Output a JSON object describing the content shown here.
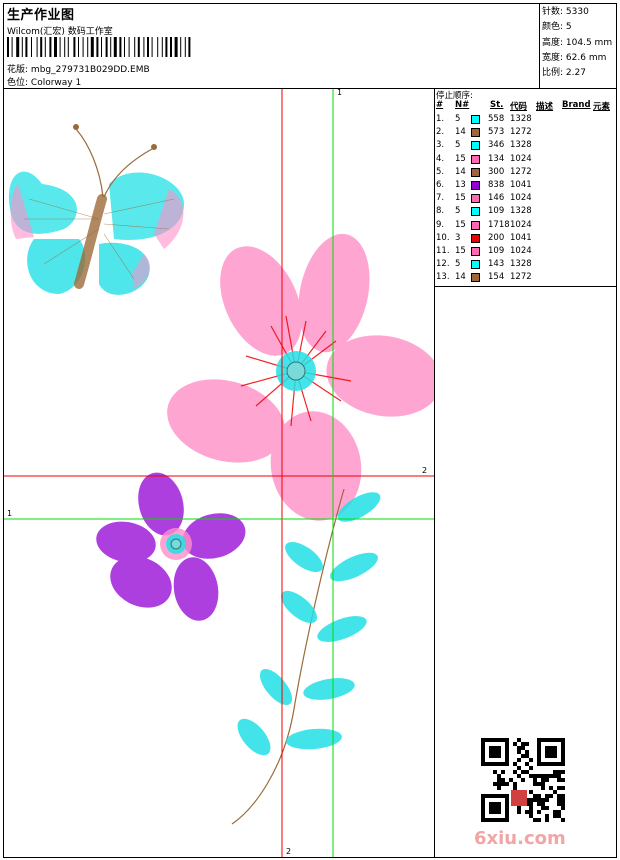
{
  "header": {
    "title": "生产作业图",
    "company": "Wilcom(汇宏) 数码工作室",
    "design_label": "花版:",
    "design_file": "mbg_279731B029DD.EMB",
    "colorway_label": "色位:",
    "colorway": "Colorway 1"
  },
  "stats": [
    {
      "label": "针数:",
      "value": "5330"
    },
    {
      "label": "颜色:",
      "value": "5"
    },
    {
      "label": "高度:",
      "value": "104.5 mm"
    },
    {
      "label": "宽度:",
      "value": "62.6 mm"
    },
    {
      "label": "比例:",
      "value": "2.27"
    }
  ],
  "legend": {
    "title": "停止顺序:",
    "headers": {
      "num": "#",
      "needle": "N#",
      "stitches": "St.",
      "code": "代码",
      "desc": "描述",
      "brand": "Brand",
      "elem": "元素"
    },
    "rows": [
      {
        "n": "1.",
        "needle": "5",
        "color": "#00ffff",
        "st": "558",
        "code": "1328"
      },
      {
        "n": "2.",
        "needle": "14",
        "color": "#a0643c",
        "st": "573",
        "code": "1272"
      },
      {
        "n": "3.",
        "needle": "5",
        "color": "#00ffff",
        "st": "346",
        "code": "1328"
      },
      {
        "n": "4.",
        "needle": "15",
        "color": "#ff69b4",
        "st": "134",
        "code": "1024"
      },
      {
        "n": "5.",
        "needle": "14",
        "color": "#a0643c",
        "st": "300",
        "code": "1272"
      },
      {
        "n": "6.",
        "needle": "13",
        "color": "#9400d3",
        "st": "838",
        "code": "1041"
      },
      {
        "n": "7.",
        "needle": "15",
        "color": "#ff69b4",
        "st": "146",
        "code": "1024"
      },
      {
        "n": "8.",
        "needle": "5",
        "color": "#00ffff",
        "st": "109",
        "code": "1328"
      },
      {
        "n": "9.",
        "needle": "15",
        "color": "#ff69b4",
        "st": "1718",
        "code": "1024"
      },
      {
        "n": "10.",
        "needle": "3",
        "color": "#ee0000",
        "st": "200",
        "code": "1041"
      },
      {
        "n": "11.",
        "needle": "15",
        "color": "#ff69b4",
        "st": "109",
        "code": "1024"
      },
      {
        "n": "12.",
        "needle": "5",
        "color": "#00ffff",
        "st": "143",
        "code": "1328"
      },
      {
        "n": "13.",
        "needle": "14",
        "color": "#a0643c",
        "st": "154",
        "code": "1272"
      }
    ]
  },
  "guides": {
    "red_h_label": "2",
    "red_v_label": "2",
    "green_h_label": "1",
    "green_v_label": "1"
  },
  "watermark": "6xiu.com",
  "colors": {
    "cyan": "#00e5ee",
    "pink": "#ff88c8",
    "purple": "#9a10d8",
    "brown": "#9c6a3a",
    "red": "#ee0000",
    "green": "#00dd00"
  }
}
